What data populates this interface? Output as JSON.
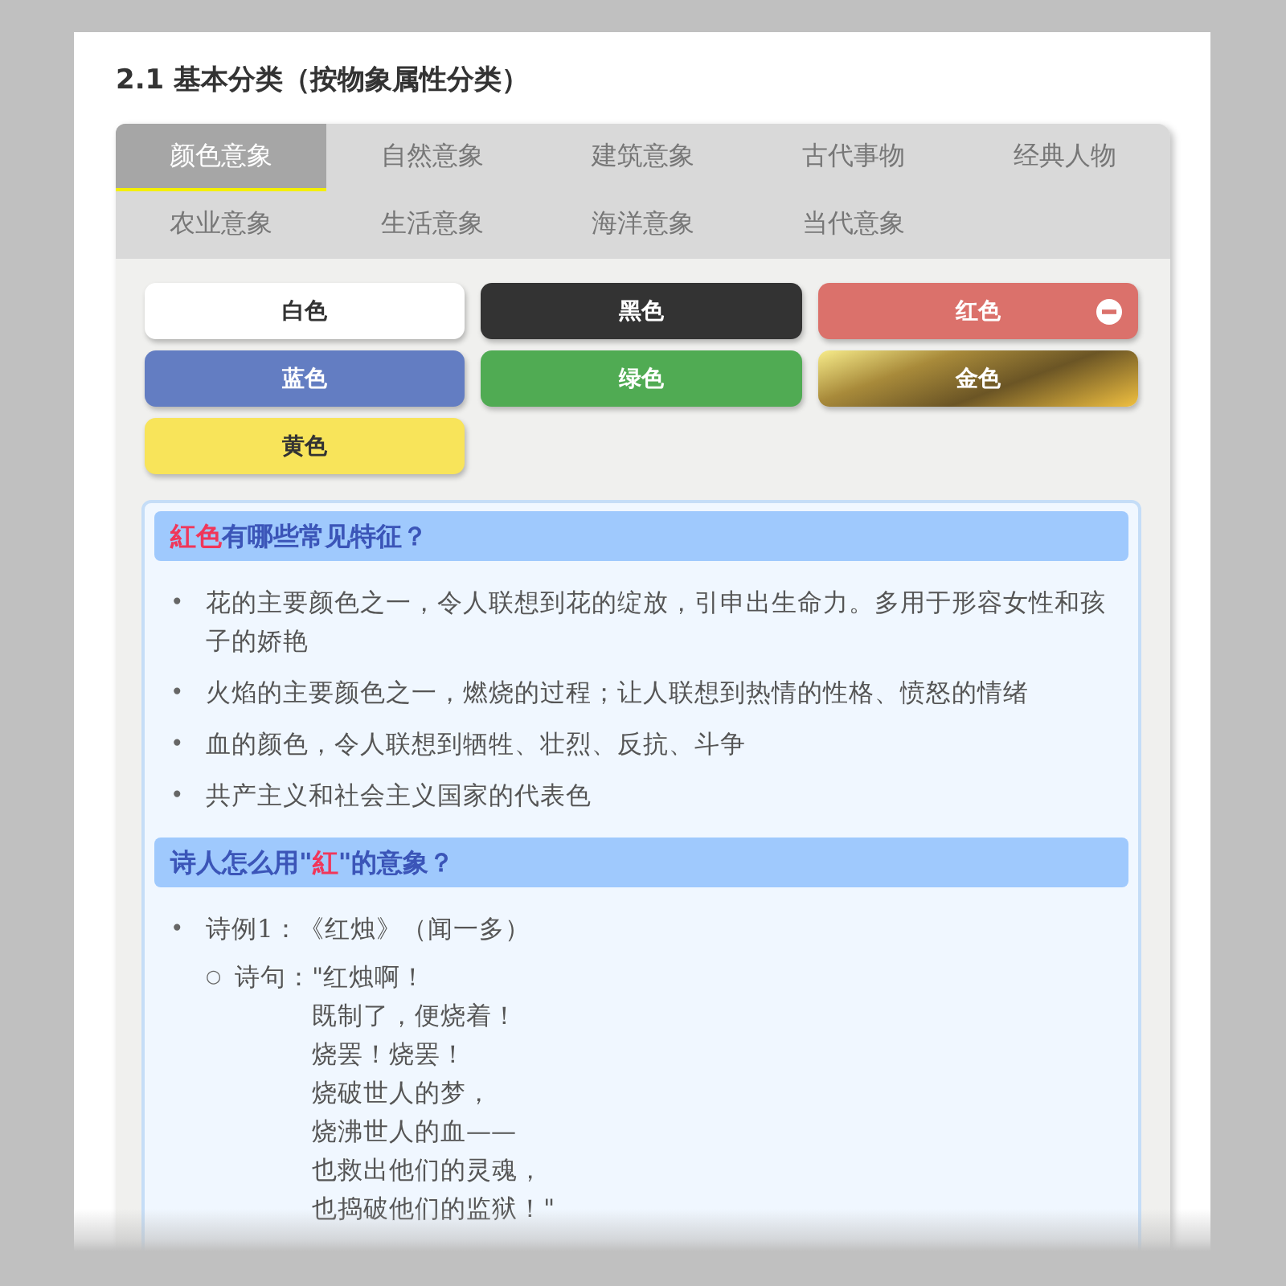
{
  "section_title": "2.1 基本分类（按物象属性分类）",
  "tabs": [
    {
      "label": "颜色意象",
      "selected": true
    },
    {
      "label": "自然意象",
      "selected": false
    },
    {
      "label": "建筑意象",
      "selected": false
    },
    {
      "label": "古代事物",
      "selected": false
    },
    {
      "label": "经典人物",
      "selected": false
    },
    {
      "label": "农业意象",
      "selected": false
    },
    {
      "label": "生活意象",
      "selected": false
    },
    {
      "label": "海洋意象",
      "selected": false
    },
    {
      "label": "当代意象",
      "selected": false
    }
  ],
  "chips": [
    {
      "label": "白色",
      "color": "#ffffff",
      "kind": "solid",
      "selected": false
    },
    {
      "label": "黑色",
      "color": "#333333",
      "kind": "solid",
      "selected": false
    },
    {
      "label": "红色",
      "color": "#db716b",
      "kind": "solid",
      "selected": true
    },
    {
      "label": "蓝色",
      "color": "#637dc2",
      "kind": "solid",
      "selected": false
    },
    {
      "label": "绿色",
      "color": "#50ab53",
      "kind": "solid",
      "selected": false
    },
    {
      "label": "金色",
      "color": "#a88a3a",
      "kind": "metallic",
      "selected": false
    },
    {
      "label": "黄色",
      "color": "#f8e45a",
      "kind": "solid",
      "selected": false
    }
  ],
  "sections": [
    {
      "heading": [
        {
          "text": "紅色",
          "kind": "highlight"
        },
        {
          "text": "有哪些常见特征？",
          "kind": "plain"
        }
      ],
      "items": [
        {
          "marker": "•",
          "text": "花的主要颜色之一，令人联想到花的绽放，引申出生命力。多用于形容女性和孩子的娇艳"
        },
        {
          "marker": "•",
          "text": "火焰的主要颜色之一，燃烧的过程；让人联想到热情的性格、愤怒的情绪"
        },
        {
          "marker": "•",
          "text": "血的颜色，令人联想到牺牲、壮烈、反抗、斗争"
        },
        {
          "marker": "•",
          "text": "共产主义和社会主义国家的代表色"
        }
      ]
    },
    {
      "heading": [
        {
          "text": "诗人怎么用\"",
          "kind": "plain"
        },
        {
          "text": "紅",
          "kind": "highlight"
        },
        {
          "text": "\"的意象？",
          "kind": "plain"
        }
      ],
      "items": [
        {
          "marker": "•",
          "text": "诗例1：《红烛》（闻一多）",
          "children": [
            {
              "marker": "○",
              "label": "诗句：",
              "lines": [
                "\"红烛啊！",
                "既制了，便烧着！",
                "烧罢！烧罢！",
                "烧破世人的梦，",
                "烧沸世人的血——",
                "也救出他们的灵魂，",
                "也捣破他们的监狱！\""
              ]
            }
          ]
        }
      ]
    }
  ]
}
